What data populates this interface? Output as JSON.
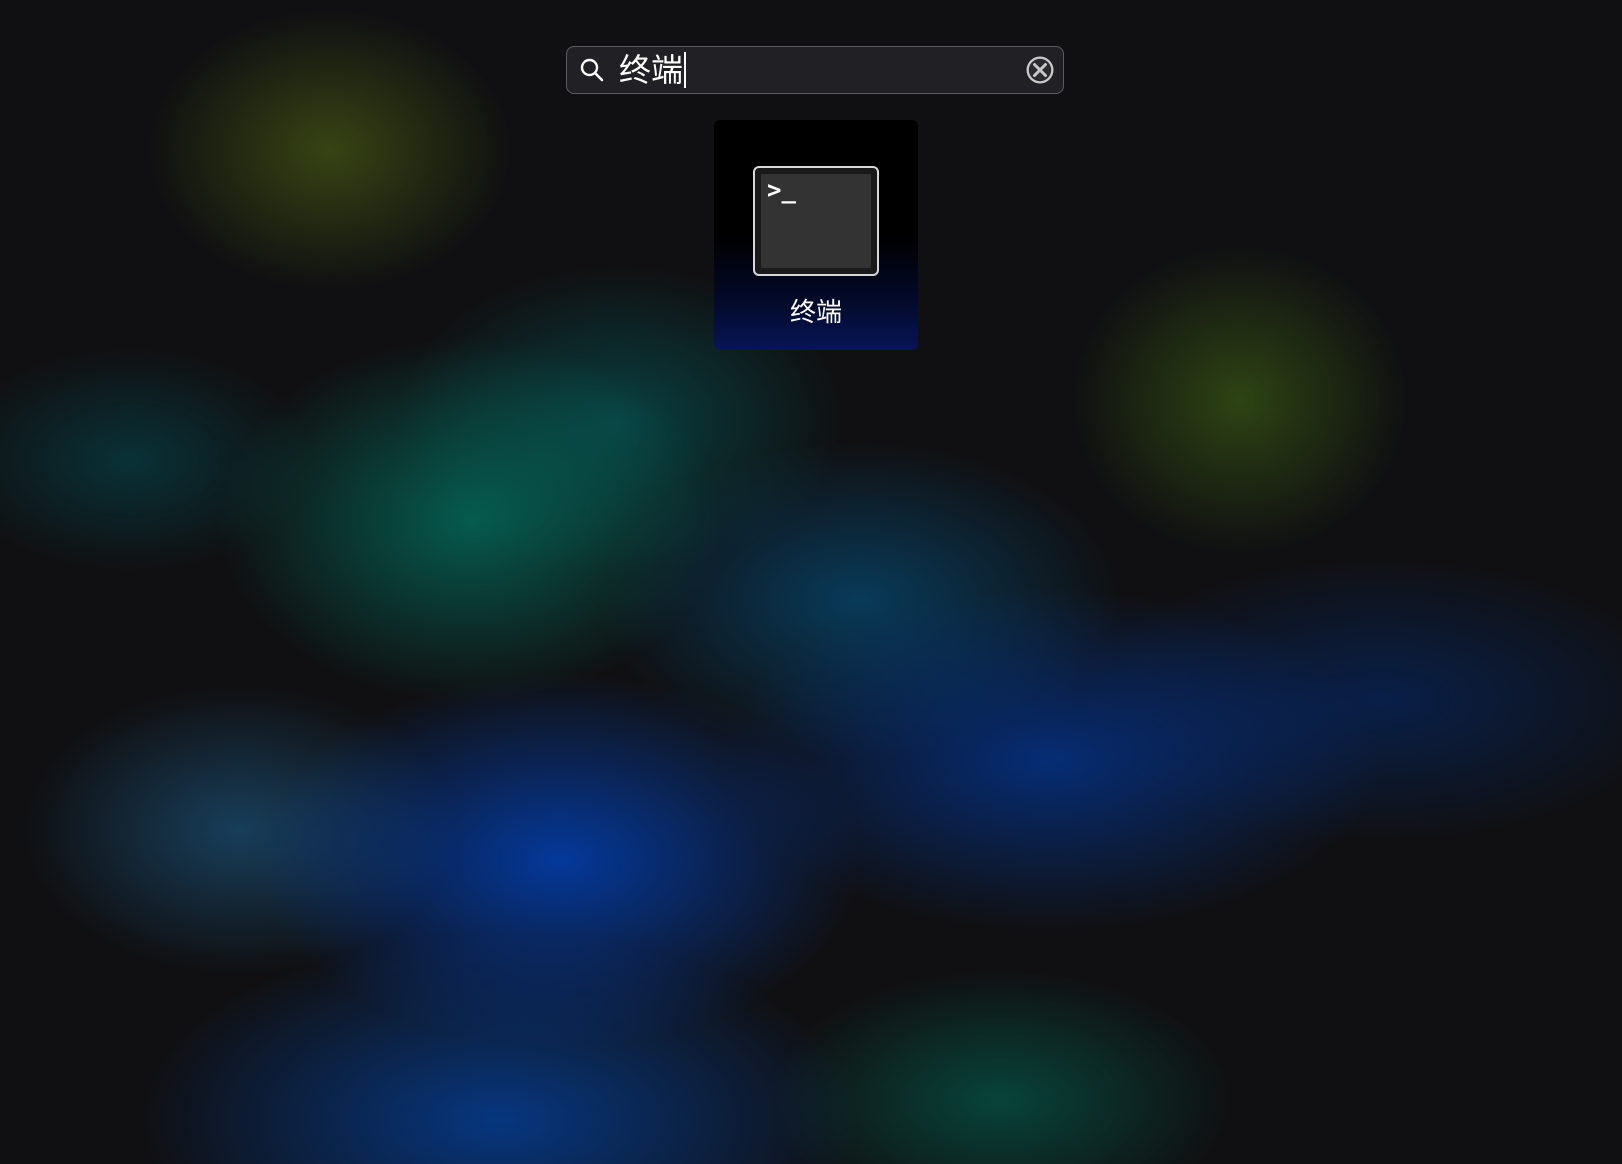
{
  "search": {
    "query": "终端",
    "icon": "search-icon",
    "clear_icon": "clear-icon"
  },
  "results": [
    {
      "label": "终端",
      "icon": "terminal-icon",
      "prompt_glyph": ">_"
    }
  ],
  "colors": {
    "background": "#101012",
    "search_border": "#5b5b60",
    "text": "#ffffff",
    "terminal_screen": "#333333"
  }
}
